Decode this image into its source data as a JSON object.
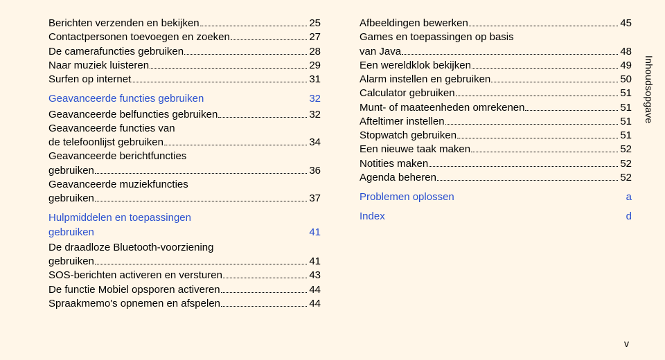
{
  "side_tab": "Inhoudsopgave",
  "page_number": "v",
  "left_column": [
    {
      "type": "item",
      "label": "Berichten verzenden en bekijken",
      "page": "25"
    },
    {
      "type": "item",
      "label": "Contactpersonen toevoegen en zoeken",
      "page": "27"
    },
    {
      "type": "item",
      "label": "De camerafuncties gebruiken",
      "page": "28"
    },
    {
      "type": "item",
      "label": "Naar muziek luisteren",
      "page": "29"
    },
    {
      "type": "item",
      "label": "Surfen op internet",
      "page": "31"
    },
    {
      "type": "section",
      "label": "Geavanceerde functies gebruiken",
      "page": "32"
    },
    {
      "type": "item",
      "label": "Geavanceerde belfuncties gebruiken",
      "page": "32"
    },
    {
      "type": "item_multi",
      "label1": "Geavanceerde functies van",
      "label2": "de telefoonlijst gebruiken",
      "page": "34"
    },
    {
      "type": "item_multi",
      "label1": "Geavanceerde berichtfuncties",
      "label2": "gebruiken",
      "page": "36"
    },
    {
      "type": "item_multi",
      "label1": "Geavanceerde muziekfuncties",
      "label2": "gebruiken",
      "page": "37"
    },
    {
      "type": "section_multi",
      "label1": "Hulpmiddelen en toepassingen",
      "label2": "gebruiken",
      "page": "41"
    },
    {
      "type": "item_multi",
      "label1": "De draadloze Bluetooth-voorziening",
      "label2": "gebruiken",
      "page": "41"
    },
    {
      "type": "item",
      "label": "SOS-berichten activeren en versturen",
      "page": "43"
    },
    {
      "type": "item",
      "label": "De functie Mobiel opsporen activeren",
      "page": "44"
    },
    {
      "type": "item",
      "label": "Spraakmemo's opnemen en afspelen",
      "page": "44"
    }
  ],
  "right_column": [
    {
      "type": "item",
      "label": "Afbeeldingen bewerken",
      "page": "45"
    },
    {
      "type": "item_multi",
      "label1": "Games en toepassingen op basis",
      "label2": "van Java",
      "page": "48"
    },
    {
      "type": "item",
      "label": "Een wereldklok bekijken",
      "page": "49"
    },
    {
      "type": "item",
      "label": "Alarm instellen en gebruiken",
      "page": "50"
    },
    {
      "type": "item",
      "label": "Calculator gebruiken",
      "page": "51"
    },
    {
      "type": "item",
      "label": "Munt- of maateenheden omrekenen",
      "page": "51"
    },
    {
      "type": "item",
      "label": "Afteltimer instellen",
      "page": "51"
    },
    {
      "type": "item",
      "label": "Stopwatch gebruiken",
      "page": "51"
    },
    {
      "type": "item",
      "label": "Een nieuwe taak maken",
      "page": "52"
    },
    {
      "type": "item",
      "label": "Notities maken",
      "page": "52"
    },
    {
      "type": "item",
      "label": "Agenda beheren",
      "page": "52"
    },
    {
      "type": "section",
      "label": "Problemen oplossen",
      "page": "a"
    },
    {
      "type": "section",
      "label": "Index",
      "page": "d"
    }
  ]
}
